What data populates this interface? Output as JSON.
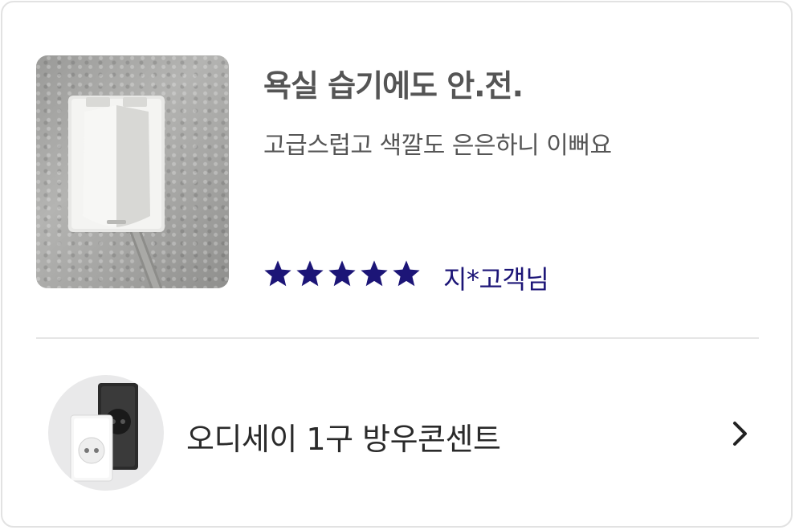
{
  "review": {
    "title": "욕실 습기에도 안.전.",
    "body": "고급스럽고 색깔도 은은하니 이뻐요",
    "rating": 5,
    "rating_max": 5,
    "reviewer": "지*고객님",
    "star_color": "#1c1577"
  },
  "product": {
    "name": "오디세이 1구 방우콘센트"
  },
  "icons": {
    "star": "star-icon",
    "chevron": "chevron-right-icon"
  }
}
